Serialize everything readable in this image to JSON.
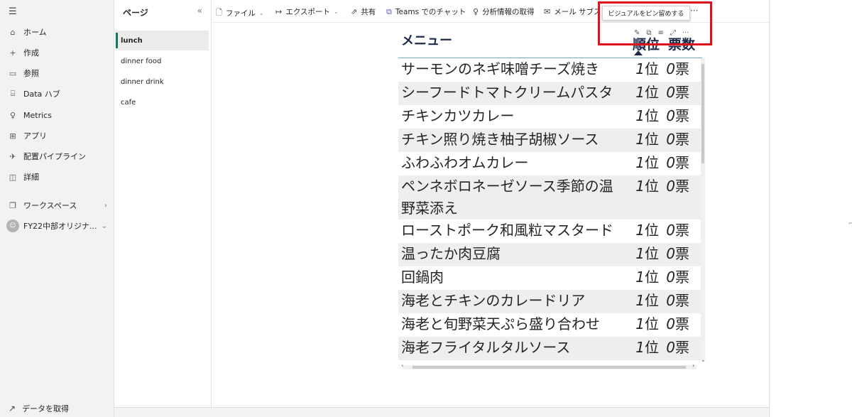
{
  "leftnav": {
    "menu_icon": "hamburger-icon",
    "items": [
      {
        "icon": "home-icon",
        "glyph": "⌂",
        "label": "ホーム"
      },
      {
        "icon": "plus-icon",
        "glyph": "+",
        "label": "作成"
      },
      {
        "icon": "folder-icon",
        "glyph": "▭",
        "label": "参照"
      },
      {
        "icon": "data-hub-icon",
        "glyph": "⌸",
        "label": "Data ハブ"
      },
      {
        "icon": "metrics-icon",
        "glyph": "♀",
        "label": "Metrics"
      },
      {
        "icon": "apps-icon",
        "glyph": "⊞",
        "label": "アプリ"
      },
      {
        "icon": "rocket-icon",
        "glyph": "✈",
        "label": "配置パイプライン"
      },
      {
        "icon": "book-icon",
        "glyph": "◫",
        "label": "詳細"
      }
    ],
    "workspaces": {
      "label": "ワークスペース",
      "glyph": "❐"
    },
    "current_workspace": {
      "label": "FY22中部オリジナ..."
    },
    "get_data": {
      "label": "データを取得",
      "glyph": "↗"
    }
  },
  "pages": {
    "title": "ページ",
    "collapse_glyph": "«",
    "items": [
      {
        "label": "lunch",
        "active": true
      },
      {
        "label": "dinner food",
        "active": false
      },
      {
        "label": "dinner drink",
        "active": false
      },
      {
        "label": "cafe",
        "active": false
      }
    ]
  },
  "toolbar": {
    "file": {
      "label": "ファイル",
      "glyph": "🗋"
    },
    "export": {
      "label": "エクスポート",
      "glyph": "↦"
    },
    "share": {
      "label": "共有",
      "glyph": "⇗"
    },
    "teams": {
      "label": "Teams でのチャット",
      "glyph": "⧉"
    },
    "insights": {
      "label": "分析情報の取得",
      "glyph": "♀"
    },
    "subscribe": {
      "label": "メール サブス",
      "glyph": "✉"
    },
    "more": "···"
  },
  "tooltip": {
    "text": "ビジュアルをピン留めする"
  },
  "visual": {
    "title": "メニュー",
    "col_rank": "順位",
    "col_votes": "票数",
    "rows": [
      {
        "name": "サーモンのネギ味噌チーズ焼き",
        "rank": "1",
        "rank_unit": "位",
        "votes": "0",
        "votes_unit": "票"
      },
      {
        "name": "シーフードトマトクリームパスタ",
        "rank": "1",
        "rank_unit": "位",
        "votes": "0",
        "votes_unit": "票"
      },
      {
        "name": "チキンカツカレー",
        "rank": "1",
        "rank_unit": "位",
        "votes": "0",
        "votes_unit": "票"
      },
      {
        "name": "チキン照り焼き柚子胡椒ソース",
        "rank": "1",
        "rank_unit": "位",
        "votes": "0",
        "votes_unit": "票"
      },
      {
        "name": "ふわふわオムカレー",
        "rank": "1",
        "rank_unit": "位",
        "votes": "0",
        "votes_unit": "票"
      },
      {
        "name": "ペンネボロネーゼソース季節の温野菜添え",
        "rank": "1",
        "rank_unit": "位",
        "votes": "0",
        "votes_unit": "票"
      },
      {
        "name": "ローストポーク和風粒マスタード",
        "rank": "1",
        "rank_unit": "位",
        "votes": "0",
        "votes_unit": "票"
      },
      {
        "name": "温ったか肉豆腐",
        "rank": "1",
        "rank_unit": "位",
        "votes": "0",
        "votes_unit": "票"
      },
      {
        "name": "回鍋肉",
        "rank": "1",
        "rank_unit": "位",
        "votes": "0",
        "votes_unit": "票"
      },
      {
        "name": "海老とチキンのカレードリア",
        "rank": "1",
        "rank_unit": "位",
        "votes": "0",
        "votes_unit": "票"
      },
      {
        "name": "海老と旬野菜天ぷら盛り合わせ",
        "rank": "1",
        "rank_unit": "位",
        "votes": "0",
        "votes_unit": "票"
      },
      {
        "name": "海老フライタルタルソース",
        "rank": "1",
        "rank_unit": "位",
        "votes": "0",
        "votes_unit": "票"
      }
    ]
  },
  "colors": {
    "highlight": "#e0131c",
    "header_text": "#1b2a4a",
    "active_page_bar": "#117865",
    "header_line": "#6aa6d6"
  }
}
